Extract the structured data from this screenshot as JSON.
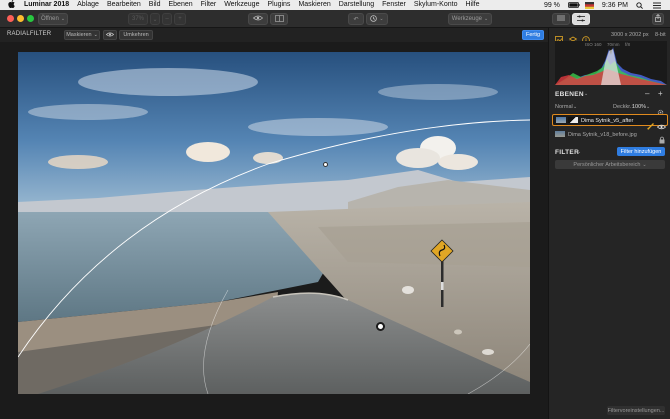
{
  "menubar": {
    "app_name": "Luminar 2018",
    "items": [
      "Ablage",
      "Bearbeiten",
      "Bild",
      "Ebenen",
      "Filter",
      "Werkzeuge",
      "Plugins",
      "Maskieren",
      "Darstellung",
      "Fenster",
      "Skylum-Konto",
      "Hilfe"
    ],
    "battery": "99 %",
    "time": "9:36 PM"
  },
  "toolbar": {
    "open_label": "Öffnen",
    "zoom_value": "37%",
    "tools_dropdown": "Werkzeuge"
  },
  "subbar": {
    "title": "RADIALFILTER",
    "mask_dropdown": "Maskieren",
    "invert_label": "Umkehren",
    "done_label": "Fertig"
  },
  "panel": {
    "image_size": "3000 x 2002 px",
    "bit_depth": "8-bit",
    "exif": {
      "iso": "ISO 160",
      "focal": "70mm",
      "aperture": "f/8"
    },
    "layers_title": "EBENEN",
    "blend_mode": "Normal",
    "opacity_label": "Deckkr.:",
    "opacity_value": "100%",
    "layers": [
      {
        "name": "Dima Sytnik_v5_after",
        "selected": true
      },
      {
        "name": "Dima Sytnik_v18_before.jpg",
        "selected": false
      }
    ],
    "filter_title": "FILTER",
    "add_filter_label": "Filter hinzufügen",
    "workspace_label": "Persönlicher Arbeitsbereich",
    "presets_label": "Filtervoreinstellungen..."
  },
  "colors": {
    "accent_blue": "#2f7de1",
    "selection_orange": "#e08a1e",
    "window_bg": "#1b1b1b"
  }
}
